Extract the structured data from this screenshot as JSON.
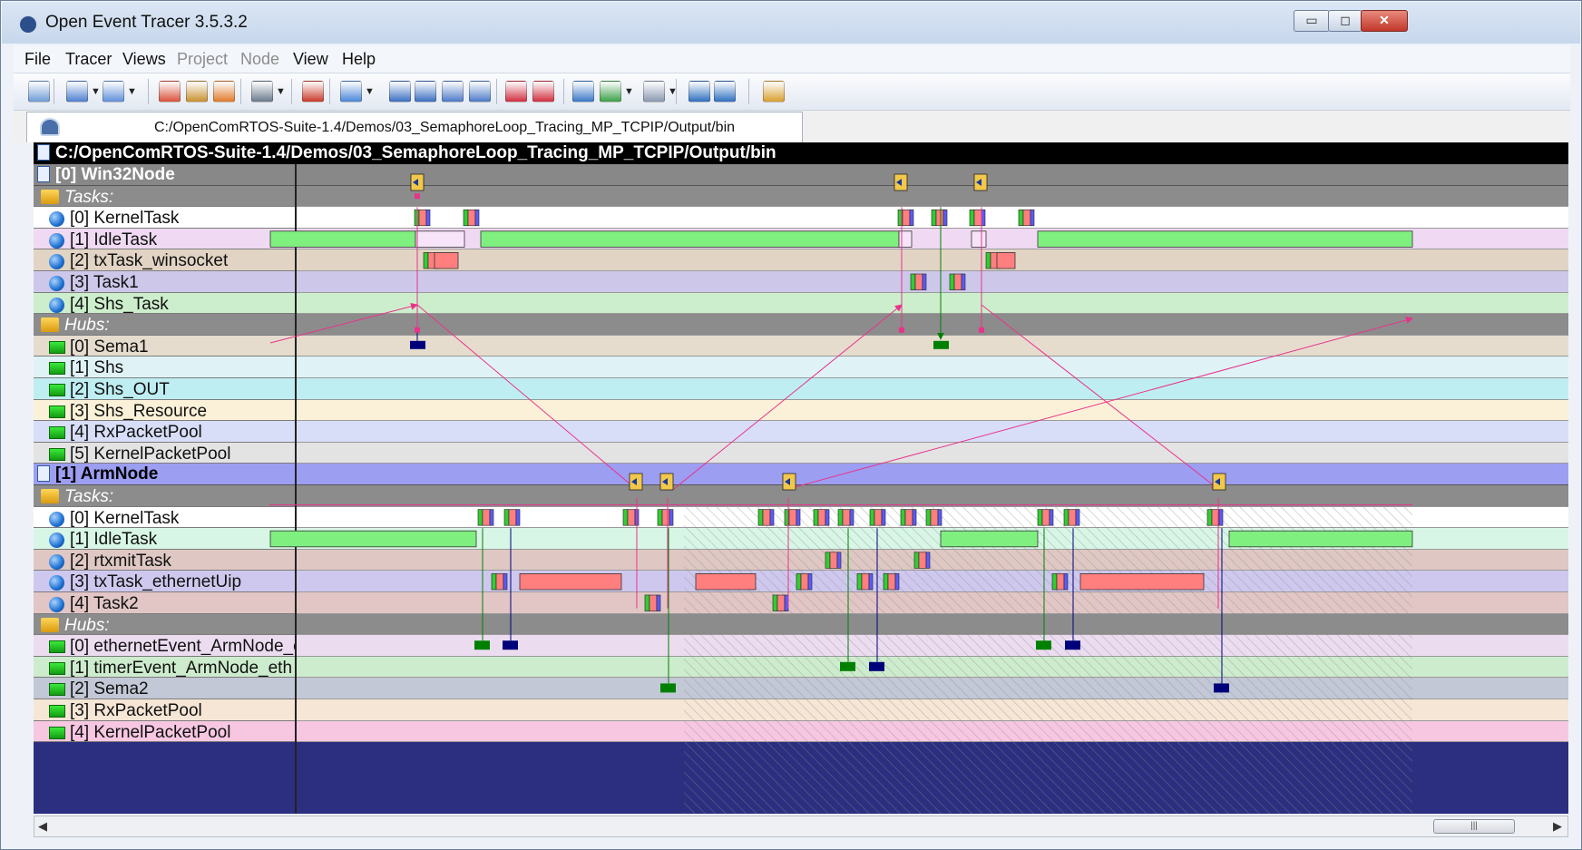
{
  "window": {
    "title": "Open Event Tracer 3.5.3.2",
    "controls": [
      {
        "name": "minimize-button",
        "glyph": "▭"
      },
      {
        "name": "maximize-button",
        "glyph": "◻"
      },
      {
        "name": "close-button",
        "glyph": "✕"
      }
    ]
  },
  "menu": [
    {
      "label": "File",
      "enabled": true
    },
    {
      "label": "Tracer",
      "enabled": true
    },
    {
      "label": "Views",
      "enabled": true
    },
    {
      "label": "Project",
      "enabled": false
    },
    {
      "label": "Node",
      "enabled": false
    },
    {
      "label": "View",
      "enabled": true
    },
    {
      "label": "Help",
      "enabled": true
    }
  ],
  "toolbar": {
    "items": [
      {
        "icon": "open-trace-icon",
        "color": "#6f9bd6",
        "dropdown": false
      },
      {
        "icon": "save-trace-icon",
        "color": "#4f7fcf",
        "dropdown": true
      },
      {
        "icon": "export-icon",
        "color": "#5f8fd8",
        "dropdown": true
      },
      {
        "icon": "record-tasks-icon",
        "color": "#d9503a",
        "dropdown": false
      },
      {
        "icon": "record-hubs-icon",
        "color": "#c89030",
        "dropdown": false
      },
      {
        "icon": "record-links-icon",
        "color": "#e07a2a",
        "dropdown": false
      },
      {
        "icon": "layout-icon",
        "color": "#6b7a8c",
        "dropdown": true
      },
      {
        "icon": "filter-icon",
        "color": "#c83a2a",
        "dropdown": false
      },
      {
        "icon": "node-view-icon",
        "color": "#4a86d8",
        "dropdown": true
      },
      {
        "icon": "expand-all-icon",
        "color": "#3b6fc0",
        "dropdown": false
      },
      {
        "icon": "collapse-all-icon",
        "color": "#3b6fc0",
        "dropdown": false
      },
      {
        "icon": "stack-view-icon",
        "color": "#4d7ac7",
        "dropdown": false
      },
      {
        "icon": "refresh-view-icon",
        "color": "#4d7ac7",
        "dropdown": false
      },
      {
        "icon": "previous-event-icon",
        "color": "#d03040",
        "dropdown": false
      },
      {
        "icon": "next-event-icon",
        "color": "#d03040",
        "dropdown": false
      },
      {
        "icon": "link-mode-icon",
        "color": "#3a78c8",
        "dropdown": false
      },
      {
        "icon": "statistics-icon",
        "color": "#3ca048",
        "dropdown": true
      },
      {
        "icon": "grid-icon",
        "color": "#8a98b0",
        "dropdown": true
      },
      {
        "icon": "zoom-in-icon",
        "color": "#2f6fbf",
        "dropdown": false
      },
      {
        "icon": "zoom-out-icon",
        "color": "#2f6fbf",
        "dropdown": false
      },
      {
        "icon": "book-icon",
        "color": "#d8a030",
        "dropdown": false
      }
    ]
  },
  "tab": {
    "label": "C:/OpenComRTOS-Suite-1.4/Demos/03_SemaphoreLoop_Tracing_MP_TCPIP/Output/bin",
    "icon": "trace-tab-icon"
  },
  "trace": {
    "path_header": "C:/OpenComRTOS-Suite-1.4/Demos/03_SemaphoreLoop_Tracing_MP_TCPIP/Output/bin",
    "nodes": [
      {
        "name": "[0] Win32Node",
        "tasks_label": "Tasks:",
        "tasks": [
          {
            "label": "[0] KernelTask",
            "bg": "#ffffff"
          },
          {
            "label": "[1] IdleTask",
            "bg": "#f0d9f3"
          },
          {
            "label": "[2] txTask_winsocket",
            "bg": "#e2d4c4"
          },
          {
            "label": "[3] Task1",
            "bg": "#cdc8ea"
          },
          {
            "label": "[4] Shs_Task",
            "bg": "#cceecc"
          }
        ],
        "hubs_label": "Hubs:",
        "hubs": [
          {
            "label": "[0] Sema1",
            "bg": "#e6dcce"
          },
          {
            "label": "[1] Shs",
            "bg": "#dff3f7"
          },
          {
            "label": "[2] Shs_OUT",
            "bg": "#bfeef2"
          },
          {
            "label": "[3] Shs_Resource",
            "bg": "#fbf1d8"
          },
          {
            "label": "[4] RxPacketPool",
            "bg": "#d8def7"
          },
          {
            "label": "[5] KernelPacketPool",
            "bg": "#e3e3e3"
          }
        ]
      },
      {
        "name": "[1] ArmNode",
        "tasks_label": "Tasks:",
        "tasks": [
          {
            "label": "[0] KernelTask",
            "bg": "#ffffff"
          },
          {
            "label": "[1] IdleTask",
            "bg": "#d8f6e6"
          },
          {
            "label": "[2] rtxmitTask",
            "bg": "#dfc8c4"
          },
          {
            "label": "[3] txTask_ethernetUip",
            "bg": "#cfc8ee"
          },
          {
            "label": "[4] Task2",
            "bg": "#e2c6c6"
          }
        ],
        "hubs_label": "Hubs:",
        "hubs": [
          {
            "label": "[0] ethernetEvent_ArmNode_e",
            "bg": "#ecdcf0"
          },
          {
            "label": "[1] timerEvent_ArmNode_eth",
            "bg": "#cdeccd"
          },
          {
            "label": "[2] Sema2",
            "bg": "#c3c8d6"
          },
          {
            "label": "[3] RxPacketPool",
            "bg": "#f6e6d6"
          },
          {
            "label": "[4] KernelPacketPool",
            "bg": "#f7c7e2"
          }
        ]
      }
    ]
  },
  "colors": {
    "running": "#ff7f7f",
    "idle_running": "#7fef7f",
    "handoff_green": "#33cc33",
    "handoff_blue": "#5b5bff",
    "message_link": "#e8338a",
    "signal_green": "#008000",
    "signal_navy": "#00007a",
    "node_header_0": "#888888",
    "node_header_1": "#9c9ef2"
  }
}
